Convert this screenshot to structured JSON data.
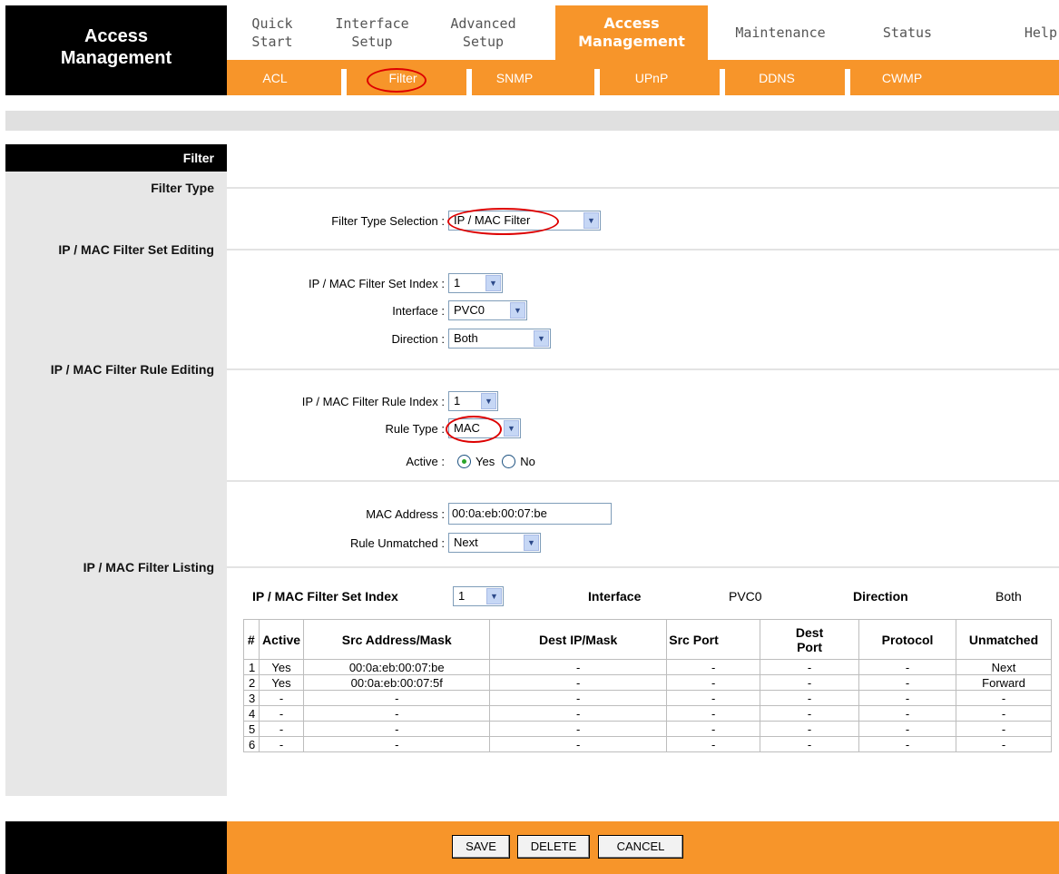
{
  "brand": {
    "line1": "Access",
    "line2": "Management"
  },
  "main_nav": [
    {
      "line1": "Quick",
      "line2": "Start"
    },
    {
      "line1": "Interface",
      "line2": "Setup"
    },
    {
      "line1": "Advanced",
      "line2": "Setup"
    },
    {
      "line1": "Access",
      "line2": "Management",
      "active": true
    },
    {
      "line1": "Maintenance",
      "line2": ""
    },
    {
      "line1": "Status",
      "line2": ""
    },
    {
      "line1": "Help",
      "line2": ""
    }
  ],
  "sub_nav": [
    "ACL",
    "Filter",
    "SNMP",
    "UPnP",
    "DDNS",
    "CWMP"
  ],
  "sections": {
    "filter": "Filter",
    "filter_type": "Filter Type",
    "set_editing": "IP / MAC Filter Set Editing",
    "rule_editing": "IP / MAC Filter Rule Editing",
    "listing": "IP / MAC Filter Listing"
  },
  "form": {
    "filter_type_label": "Filter Type Selection :",
    "filter_type_value": "IP / MAC Filter",
    "set_index_label": "IP / MAC Filter Set Index :",
    "set_index_value": "1",
    "interface_label": "Interface :",
    "interface_value": "PVC0",
    "direction_label": "Direction :",
    "direction_value": "Both",
    "rule_index_label": "IP / MAC Filter Rule Index :",
    "rule_index_value": "1",
    "rule_type_label": "Rule Type :",
    "rule_type_value": "MAC",
    "active_label": "Active :",
    "active_yes": "Yes",
    "active_no": "No",
    "mac_label": "MAC Address :",
    "mac_value": "00:0a:eb:00:07:be",
    "unmatched_label": "Rule Unmatched :",
    "unmatched_value": "Next"
  },
  "listing": {
    "set_index_label": "IP / MAC Filter Set Index",
    "set_index_value": "1",
    "interface_label": "Interface",
    "interface_value": "PVC0",
    "direction_label": "Direction",
    "direction_value": "Both",
    "columns": [
      "#",
      "Active",
      "Src Address/Mask",
      "Dest IP/Mask",
      "Src Port",
      "Dest Port",
      "Protocol",
      "Unmatched"
    ],
    "rows": [
      [
        "1",
        "Yes",
        "00:0a:eb:00:07:be",
        "-",
        "-",
        "-",
        "-",
        "Next"
      ],
      [
        "2",
        "Yes",
        "00:0a:eb:00:07:5f",
        "-",
        "-",
        "-",
        "-",
        "Forward"
      ],
      [
        "3",
        "-",
        "-",
        "-",
        "-",
        "-",
        "-",
        "-"
      ],
      [
        "4",
        "-",
        "-",
        "-",
        "-",
        "-",
        "-",
        "-"
      ],
      [
        "5",
        "-",
        "-",
        "-",
        "-",
        "-",
        "-",
        "-"
      ],
      [
        "6",
        "-",
        "-",
        "-",
        "-",
        "-",
        "-",
        "-"
      ]
    ]
  },
  "buttons": {
    "save": "SAVE",
    "delete": "DELETE",
    "cancel": "CANCEL"
  },
  "icons": {
    "select_arrow": "chevron-down-icon",
    "highlight": "red-ellipse-annotation"
  },
  "colors": {
    "accent": "#f7952a",
    "brand_bg": "#000000",
    "panel_gray": "#e7e7e7",
    "annotation": "#dd0000"
  }
}
